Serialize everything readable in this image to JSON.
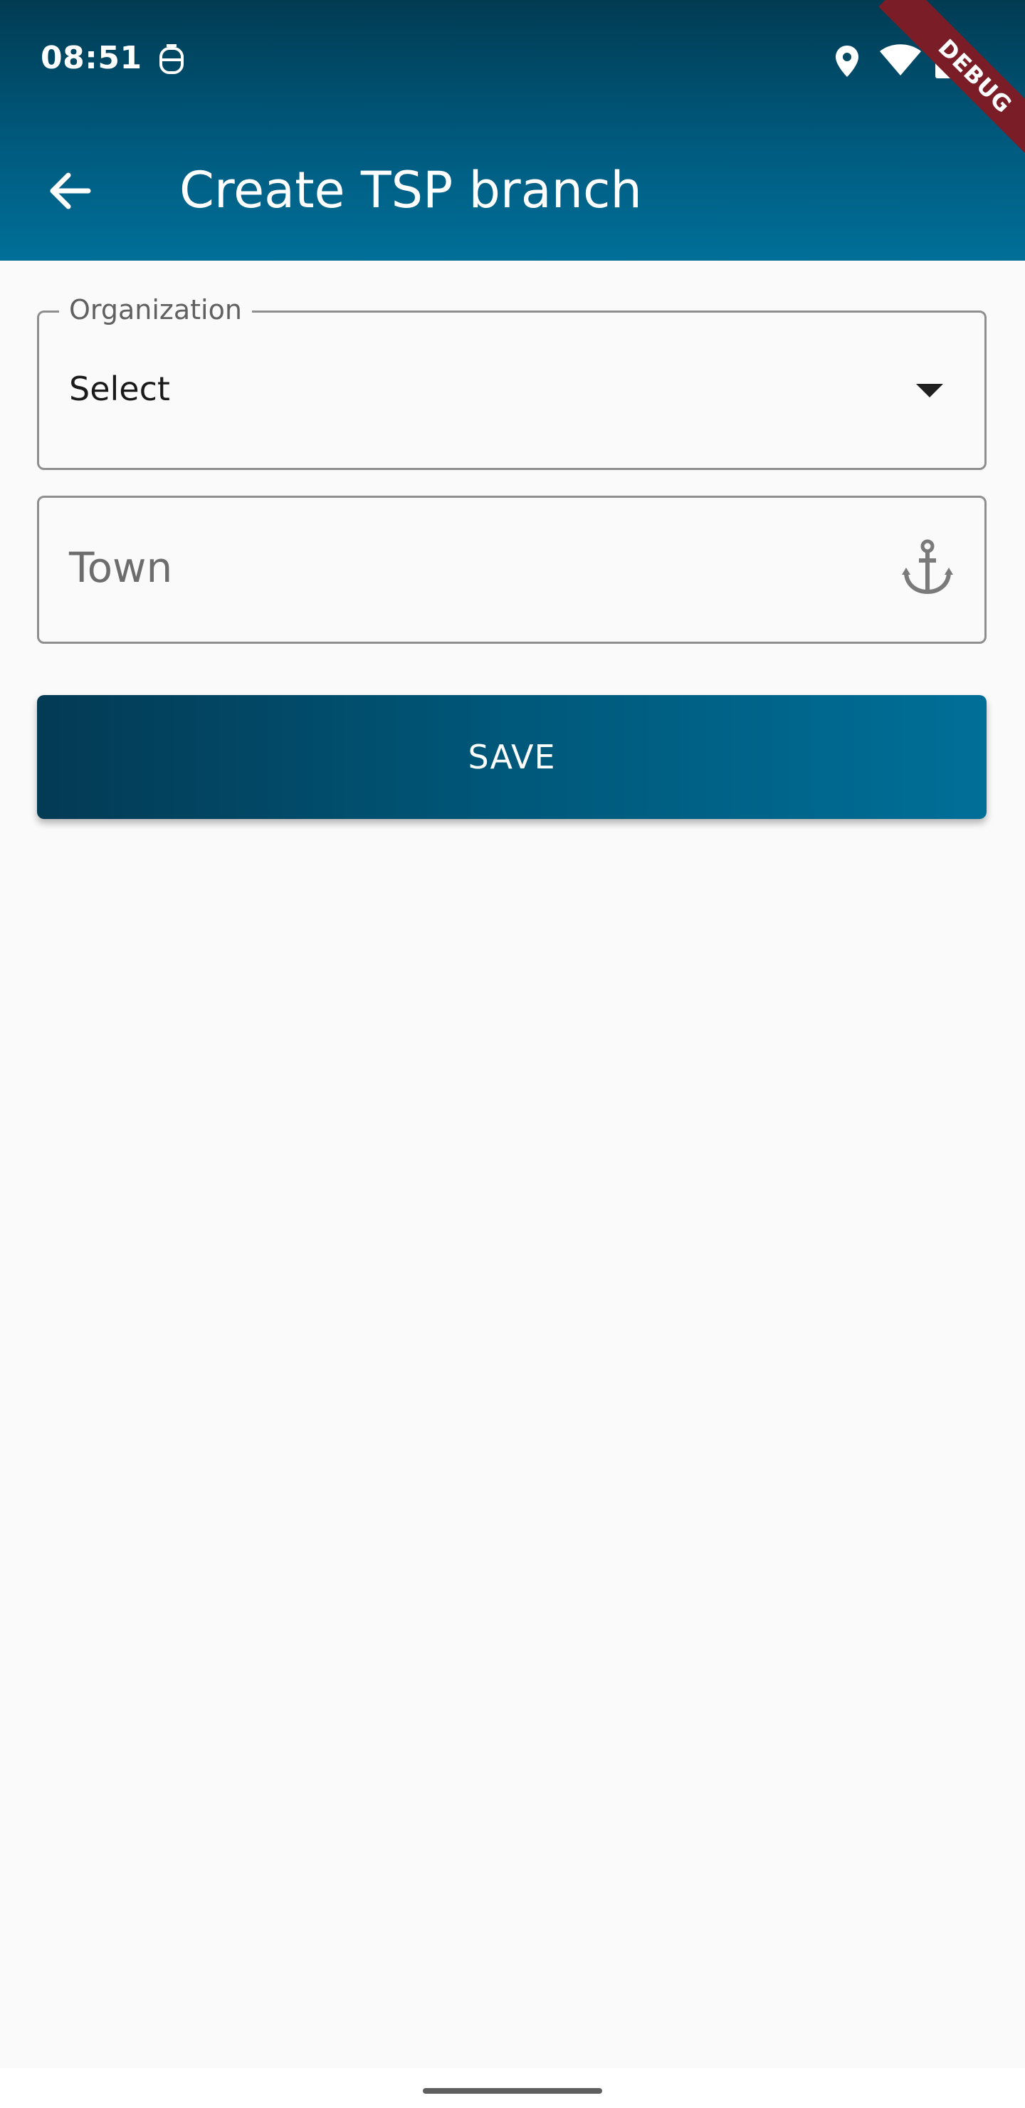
{
  "status_bar": {
    "time": "08:51",
    "icons": [
      "assistant-icon",
      "location-icon",
      "wifi-icon",
      "battery-charging-icon"
    ]
  },
  "app_bar": {
    "back_icon": "arrow-back-icon",
    "title": "Create TSP branch",
    "debug_banner": "DEBUG"
  },
  "form": {
    "organization": {
      "label": "Organization",
      "value": "Select",
      "icon": "dropdown-arrow-icon"
    },
    "town": {
      "placeholder": "Town",
      "icon": "anchor-icon"
    },
    "save_label": "SAVE"
  },
  "colors": {
    "primary_dark": "#013b52",
    "primary": "#006f98",
    "background": "#fafafa",
    "debug_banner": "#7b1d27"
  }
}
